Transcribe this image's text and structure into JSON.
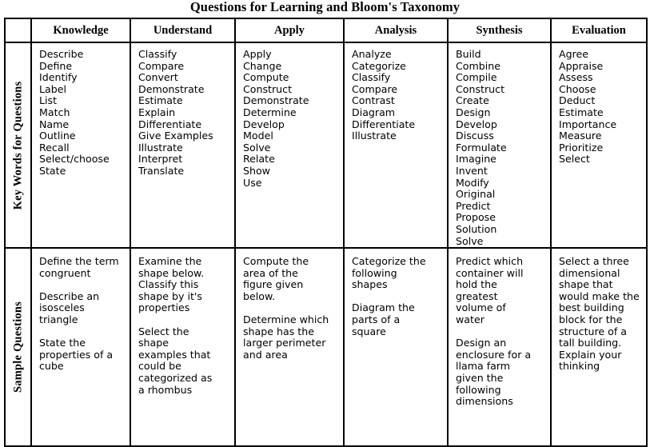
{
  "document": {
    "title": "Questions for Learning and Bloom's Taxonomy"
  },
  "table": {
    "corner_label": "",
    "columns": [
      {
        "id": "knowledge",
        "label": "Knowledge"
      },
      {
        "id": "understand",
        "label": "Understand"
      },
      {
        "id": "apply",
        "label": "Apply"
      },
      {
        "id": "analysis",
        "label": "Analysis"
      },
      {
        "id": "synthesis",
        "label": "Synthesis"
      },
      {
        "id": "evaluation",
        "label": "Evaluation"
      }
    ],
    "rows": [
      {
        "id": "key-words",
        "label": "Key Words for Questions",
        "cells": {
          "knowledge": [
            "Describe",
            "Define",
            "Identify",
            "Label",
            "List",
            "Match",
            "Name",
            "Outline",
            "Recall",
            "Select/choose",
            "State"
          ],
          "understand": [
            "Classify",
            "Compare",
            "Convert",
            "Demonstrate",
            "Estimate",
            "Explain",
            "Differentiate",
            "Give Examples",
            "Illustrate",
            "Interpret",
            "Translate"
          ],
          "apply": [
            "Apply",
            "Change",
            "Compute",
            "Construct",
            "Demonstrate",
            "Determine",
            "Develop",
            "Model",
            "Solve",
            "Relate",
            "Show",
            "Use"
          ],
          "analysis": [
            "Analyze",
            "Categorize",
            "Classify",
            "Compare",
            "Contrast",
            "Diagram",
            "Differentiate",
            "Illustrate"
          ],
          "synthesis": [
            "Build",
            "Combine",
            "Compile",
            "Construct",
            "Create",
            "Design",
            "Develop",
            "Discuss",
            "Formulate",
            "Imagine",
            "Invent",
            "Modify",
            "Original",
            "Predict",
            "Propose",
            "Solution",
            "Solve"
          ],
          "evaluation": [
            "Agree",
            "Appraise",
            "Assess",
            "Choose",
            "Deduct",
            "Estimate",
            "Importance",
            "Measure",
            "Prioritize",
            "Select"
          ]
        }
      },
      {
        "id": "sample-questions",
        "label": "Sample Questions",
        "cells": {
          "knowledge": [
            "Define the term\ncongruent",
            "Describe an\nisosceles\ntriangle",
            "State the\nproperties of a\ncube"
          ],
          "understand": [
            "Examine the\nshape below.\nClassify this\nshape by it's\nproperties",
            "Select the\nshape\nexamples that\ncould be\ncategorized as\na rhombus"
          ],
          "apply": [
            "Compute the\narea of the\nfigure given\nbelow.",
            "Determine which\nshape has the\nlarger perimeter\nand area"
          ],
          "analysis": [
            "Categorize the\nfollowing\nshapes",
            "Diagram the\nparts of a\nsquare"
          ],
          "synthesis": [
            "Predict which\ncontainer will\nhold the\ngreatest\nvolume of\nwater",
            "Design an\nenclosure for a\nllama farm\ngiven the\nfollowing\ndimensions"
          ],
          "evaluation": [
            "Select a three\ndimensional\nshape that\nwould make the\nbest building\nblock for the\nstructure of a\ntall building.\nExplain your\nthinking"
          ]
        }
      }
    ]
  },
  "style": {
    "border_color": "#000000",
    "text_color": "#000000",
    "background": "#ffffff"
  }
}
